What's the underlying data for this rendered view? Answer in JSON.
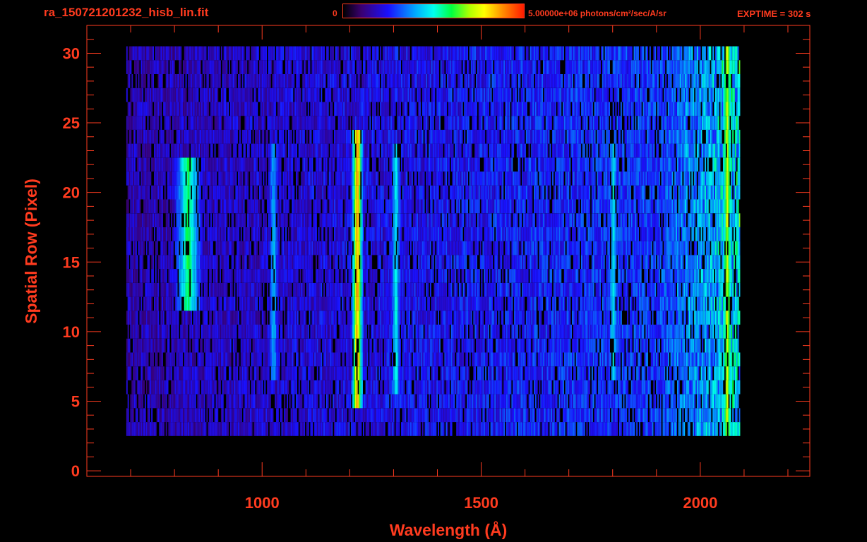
{
  "header": {
    "file_title": "ra_150721201232_hisb_lin.fit",
    "colorbar_min": "0",
    "colorbar_max": "5.00000e+06 photons/cm²/sec/A/sr",
    "exptime": "EXPTIME = 302 s"
  },
  "colors": {
    "axis": "#ff3b1f",
    "background": "#000000",
    "colormap": [
      "#000000",
      "#3a0070",
      "#1a10ff",
      "#00aaff",
      "#00ffee",
      "#00ff40",
      "#b0ff00",
      "#ffff00",
      "#ff9000",
      "#ff1a00"
    ]
  },
  "chart_data": {
    "type": "heatmap",
    "title": "ra_150721201232_hisb_lin.fit",
    "xlabel": "Wavelength (Å)",
    "ylabel": "Spatial Row (Pixel)",
    "xlim": [
      600,
      2250
    ],
    "ylim": [
      -0.4,
      32
    ],
    "x_ticks": [
      1000,
      1500,
      2000
    ],
    "y_ticks": [
      0,
      5,
      10,
      15,
      20,
      25,
      30
    ],
    "colorbar": {
      "min": 0,
      "max": 5000000,
      "units": "photons/cm²/sec/A/sr"
    },
    "rows": {
      "min": 0,
      "max": 30
    },
    "data_extent": {
      "wavelength": [
        690,
        2090
      ],
      "rows": [
        3,
        30
      ]
    },
    "features": [
      {
        "wavelength": 1216,
        "rows": [
          5,
          24
        ],
        "intensity": 0.85
      },
      {
        "wavelength": 1304,
        "rows": [
          6,
          23
        ],
        "intensity": 0.45
      },
      {
        "wavelength": 830,
        "rows": [
          12,
          22
        ],
        "intensity": 0.55
      },
      {
        "wavelength": 1025,
        "rows": [
          7,
          23
        ],
        "intensity": 0.38
      },
      {
        "wavelength": 1800,
        "rows": [
          7,
          23
        ],
        "intensity": 0.42
      },
      {
        "wavelength": 2060,
        "rows": [
          2,
          30
        ],
        "intensity": 0.7
      }
    ],
    "grid": false
  }
}
